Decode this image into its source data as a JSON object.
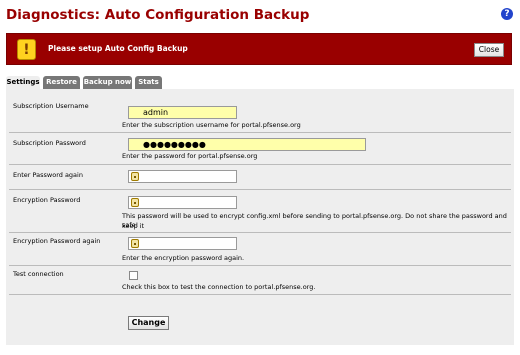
{
  "header": {
    "title": "Diagnostics: Auto Configuration Backup",
    "help_icon_label": "?"
  },
  "alert": {
    "icon_glyph": "!",
    "message": "Please setup Auto Config Backup",
    "close_label": "Close",
    "background_color": "#990000"
  },
  "tabs": [
    {
      "label": "Settings",
      "active": true
    },
    {
      "label": "Restore",
      "active": false
    },
    {
      "label": "Backup now",
      "active": false
    },
    {
      "label": "Stats",
      "active": false
    }
  ],
  "form": {
    "subscription_username": {
      "label": "Subscription Username",
      "value": "admin",
      "description": "Enter the subscription username for portal.pfsense.org"
    },
    "subscription_password": {
      "label": "Subscription Password",
      "value": "●●●●●●●●●",
      "description": "Enter the password for portal.pfsense.org"
    },
    "password_again": {
      "label": "Enter Password again",
      "value": ""
    },
    "encryption_password": {
      "label": "Encryption Password",
      "value": "",
      "description_line1": "This password will be used to encrypt config.xml before sending to portal.pfsense.org. Do not share the password and keep it",
      "description_line2": "safe!"
    },
    "encryption_password_again": {
      "label": "Encryption Password again",
      "value": "",
      "description": "Enter the encryption password again."
    },
    "test_connection": {
      "label": "Test connection",
      "checked": false,
      "description": "Check this box to test the connection to portal.pfsense.org."
    },
    "submit_label": "Change"
  }
}
